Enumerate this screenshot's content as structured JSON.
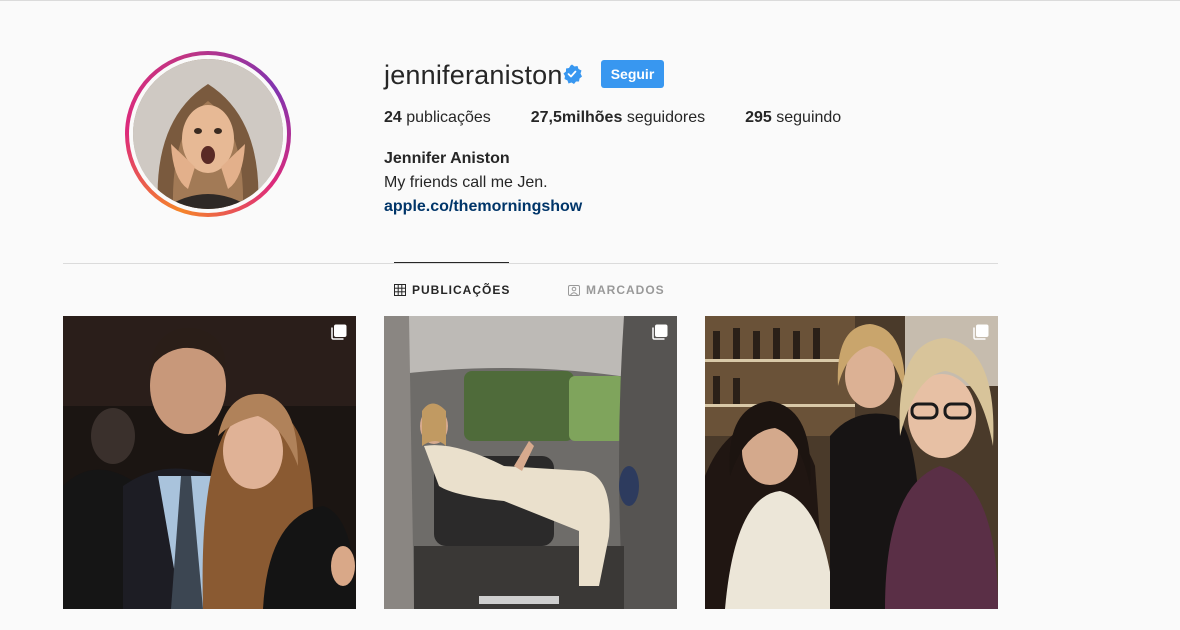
{
  "profile": {
    "username": "jenniferaniston",
    "verified_icon": "verified-badge-icon",
    "follow_label": "Seguir",
    "posts_count": "24",
    "posts_label": "publicações",
    "followers_count": "27,5milhões",
    "followers_label": "seguidores",
    "following_count": "295",
    "following_label": "seguindo",
    "full_name": "Jennifer Aniston",
    "bio": "My friends call me Jen.",
    "link": "apple.co/themorningshow"
  },
  "tabs": [
    {
      "label": "PUBLICAÇÕES",
      "icon": "grid-icon",
      "active": true
    },
    {
      "label": "MARCADOS",
      "icon": "tagged-icon",
      "active": false
    }
  ],
  "posts": [
    {
      "icon": "multiple-photos-icon"
    },
    {
      "icon": "multiple-photos-icon"
    },
    {
      "icon": "multiple-photos-icon"
    }
  ],
  "colors": {
    "accent": "#3897f0",
    "link": "#003569",
    "text": "#262626",
    "muted": "#999999",
    "background": "#fafafa"
  }
}
